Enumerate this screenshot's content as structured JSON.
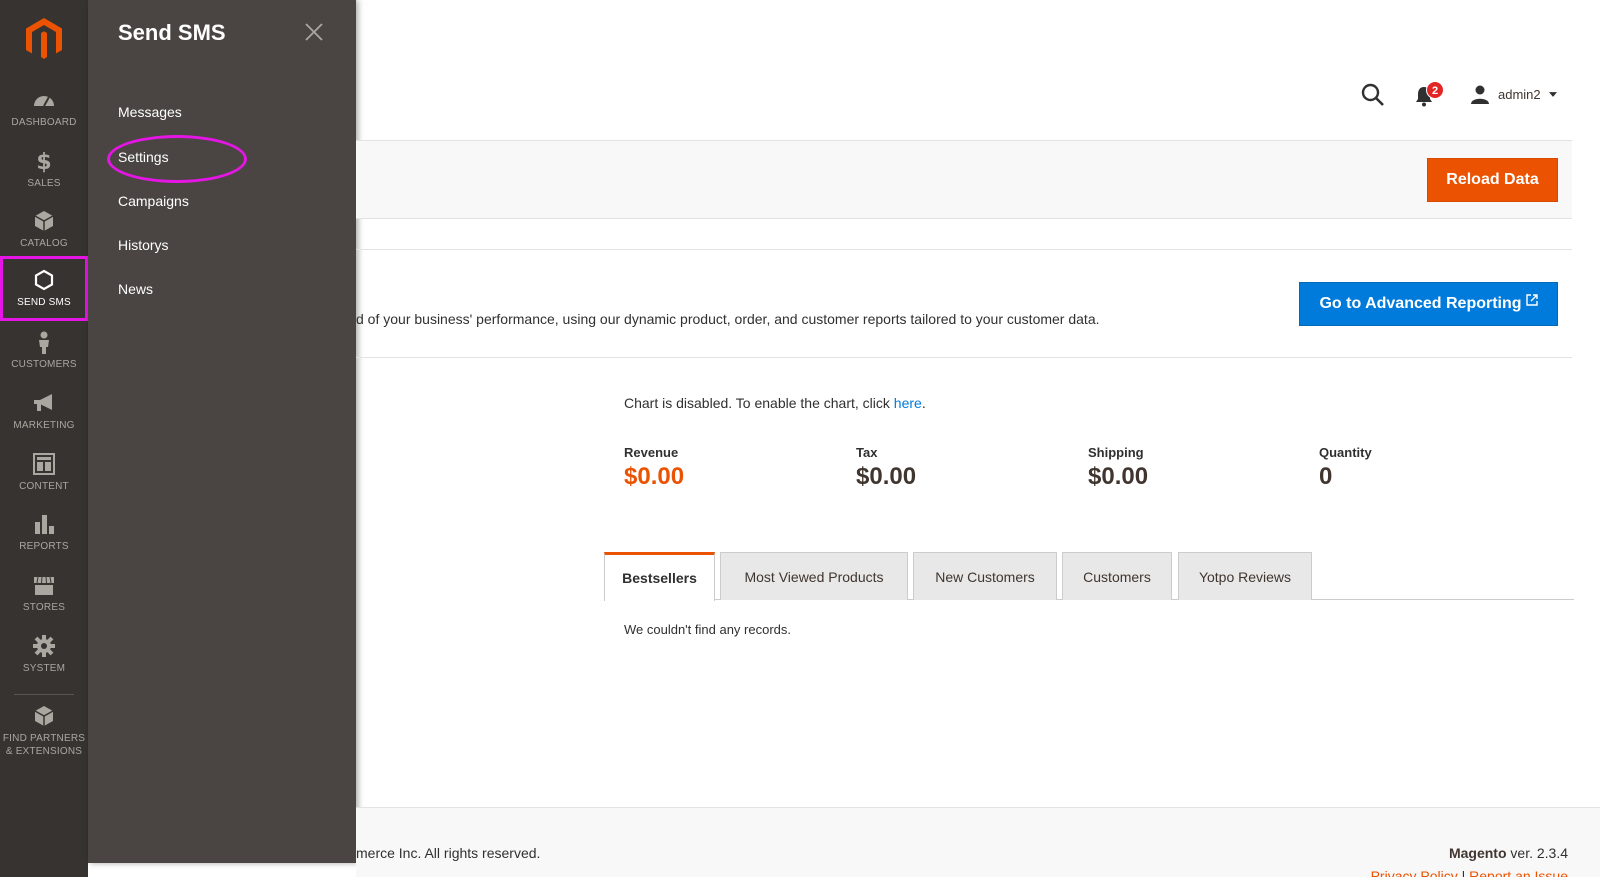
{
  "colors": {
    "sidebar_bg": "#373330",
    "submenu_bg": "#4a4542",
    "accent_orange": "#eb5202",
    "primary_blue": "#007bdb",
    "highlight_magenta": "#e516e5",
    "badge_red": "#e22626"
  },
  "leftnav": {
    "logo_icon": "magento-logo-icon",
    "items": [
      {
        "label": "DASHBOARD",
        "icon": "dashboard-icon"
      },
      {
        "label": "SALES",
        "icon": "dollar-icon"
      },
      {
        "label": "CATALOG",
        "icon": "box-icon"
      },
      {
        "label": "SEND SMS",
        "icon": "hexagon-icon"
      },
      {
        "label": "CUSTOMERS",
        "icon": "person-icon"
      },
      {
        "label": "MARKETING",
        "icon": "megaphone-icon"
      },
      {
        "label": "CONTENT",
        "icon": "layout-icon"
      },
      {
        "label": "REPORTS",
        "icon": "bar-chart-icon"
      },
      {
        "label": "STORES",
        "icon": "store-icon"
      },
      {
        "label": "SYSTEM",
        "icon": "gear-icon"
      },
      {
        "label": "FIND PARTNERS",
        "label2": "& EXTENSIONS",
        "icon": "cube-icon"
      }
    ]
  },
  "submenu": {
    "title": "Send SMS",
    "items": [
      "Messages",
      "Settings",
      "Campaigns",
      "Historys",
      "News"
    ]
  },
  "header": {
    "notifications_count": "2",
    "username": "admin2"
  },
  "actions": {
    "reload_label": "Reload Data"
  },
  "advanced_reporting": {
    "text": "d of your business' performance, using our dynamic product, order, and customer reports tailored to your customer data.",
    "button_label": "Go to Advanced Reporting"
  },
  "dashboard": {
    "chart_note_prefix": "Chart is disabled. To enable the chart, click ",
    "chart_note_link": "here",
    "chart_note_suffix": ".",
    "totals": [
      {
        "label": "Revenue",
        "value": "$0.00"
      },
      {
        "label": "Tax",
        "value": "$0.00"
      },
      {
        "label": "Shipping",
        "value": "$0.00"
      },
      {
        "label": "Quantity",
        "value": "0"
      }
    ],
    "tabs": [
      "Bestsellers",
      "Most Viewed Products",
      "New Customers",
      "Customers",
      "Yotpo Reviews"
    ],
    "active_tab": "Bestsellers",
    "empty_message": "We couldn't find any records."
  },
  "footer": {
    "copyright": "merce Inc. All rights reserved.",
    "brand": "Magento",
    "version": " ver. 2.3.4",
    "privacy_link": "Privacy Policy",
    "separator": " | ",
    "report_link": "Report an Issue"
  }
}
